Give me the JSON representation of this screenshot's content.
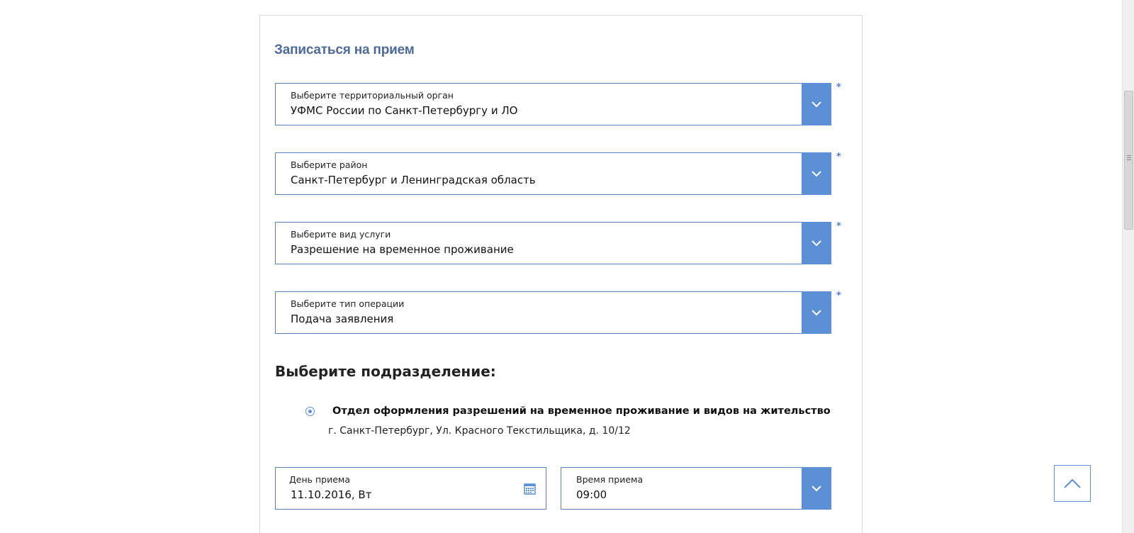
{
  "form": {
    "title": "Записаться на прием",
    "selects": [
      {
        "label": "Выберите территориальный орган",
        "value": "УФМС России по Санкт-Петербургу и ЛО",
        "required_mark": "*"
      },
      {
        "label": "Выберите район",
        "value": "Санкт-Петербург и Ленинградская область",
        "required_mark": "*"
      },
      {
        "label": "Выберите вид услуги",
        "value": "Разрешение на временное проживание",
        "required_mark": "*"
      },
      {
        "label": "Выберите тип операции",
        "value": "Подача заявления",
        "required_mark": "*"
      }
    ],
    "subdivision_heading": "Выберите подразделение:",
    "department": {
      "name": "Отдел оформления разрешений на временное проживание и видов на жительство",
      "address": "г. Санкт-Петербург, Ул. Красного Текстильщика, д. 10/12",
      "selected": true
    },
    "date_field": {
      "label": "День приема",
      "value": "11.10.2016, Вт"
    },
    "time_field": {
      "label": "Время приема",
      "value": "09:00"
    }
  },
  "icons": {
    "dropdown": "chevron-down-icon",
    "calendar": "calendar-icon",
    "scroll_top": "chevron-up-icon"
  },
  "colors": {
    "accent": "#5b8fd6",
    "border": "#5b83bb",
    "title": "#4d6b96"
  }
}
